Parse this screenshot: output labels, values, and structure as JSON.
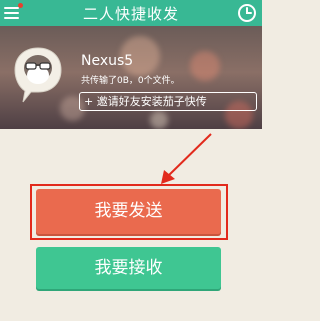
{
  "header": {
    "title": "二人快捷收发",
    "menu_icon": "menu-icon",
    "clock_icon": "clock-icon"
  },
  "profile": {
    "device_name": "Nexus5",
    "transfer_info": "共传输了0B，0个文件。",
    "invite_label": "+ 邀请好友安装茄子快传",
    "avatar_icon": "avatar-icon"
  },
  "actions": {
    "send_label": "我要发送",
    "receive_label": "我要接收"
  },
  "colors": {
    "header_bg": "#38b894",
    "send_button": "#ea6a4e",
    "receive_button": "#3fc692",
    "annotation_red": "#e22a1c",
    "background": "#f1ece2"
  }
}
